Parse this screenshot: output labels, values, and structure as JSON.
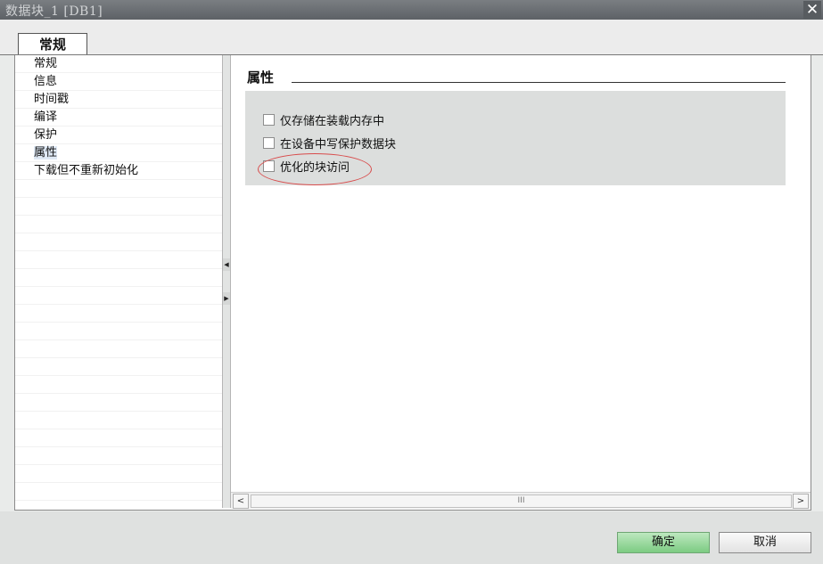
{
  "window": {
    "title": "数据块_1 [DB1]",
    "close_glyph": "✕"
  },
  "tabs": [
    {
      "label": "常规",
      "active": true
    }
  ],
  "nav": {
    "items": [
      {
        "label": "常规"
      },
      {
        "label": "信息"
      },
      {
        "label": "时间戳"
      },
      {
        "label": "编译"
      },
      {
        "label": "保护"
      },
      {
        "label": "属性",
        "selected": true
      },
      {
        "label": "下载但不重新初始化"
      }
    ]
  },
  "section": {
    "title": "属性",
    "checkboxes": [
      {
        "label": "仅存储在装载内存中",
        "checked": false
      },
      {
        "label": "在设备中写保护数据块",
        "checked": false
      },
      {
        "label": "优化的块访问",
        "checked": false,
        "highlighted": true
      }
    ]
  },
  "scrollbar": {
    "left_arrow": "<",
    "right_arrow": ">",
    "thumb_grip": "III"
  },
  "splitter": {
    "collapse_left": "◀",
    "expand_right": "▶"
  },
  "footer": {
    "ok_label": "确定",
    "cancel_label": "取消"
  },
  "colors": {
    "ok_button": "#7ccb82",
    "highlight_ring": "#d84b4b",
    "property_panel": "#dcdedd"
  }
}
